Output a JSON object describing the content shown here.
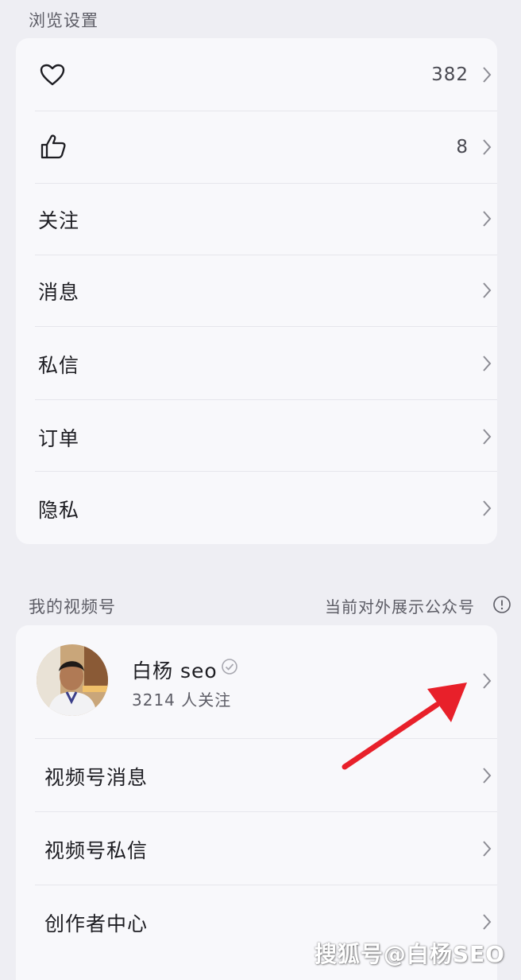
{
  "browse_settings": {
    "title": "浏览设置",
    "rows": [
      {
        "icon": "heart-icon",
        "label": "",
        "value": "382"
      },
      {
        "icon": "thumbs-up-icon",
        "label": "",
        "value": "8"
      },
      {
        "label": "关注"
      },
      {
        "label": "消息"
      },
      {
        "label": "私信"
      },
      {
        "label": "订单"
      },
      {
        "label": "隐私"
      }
    ]
  },
  "my_channel": {
    "title": "我的视频号",
    "note": "当前对外展示公众号",
    "note_icon": "info-icon",
    "channel_name": "白杨 seo",
    "followers": "3214 人关注",
    "rows": [
      {
        "label": "视频号消息"
      },
      {
        "label": "视频号私信"
      },
      {
        "label": "创作者中心"
      }
    ]
  },
  "annotation": {
    "arrow_color": "#e8202a"
  },
  "watermark": "搜狐号@白杨SEO"
}
